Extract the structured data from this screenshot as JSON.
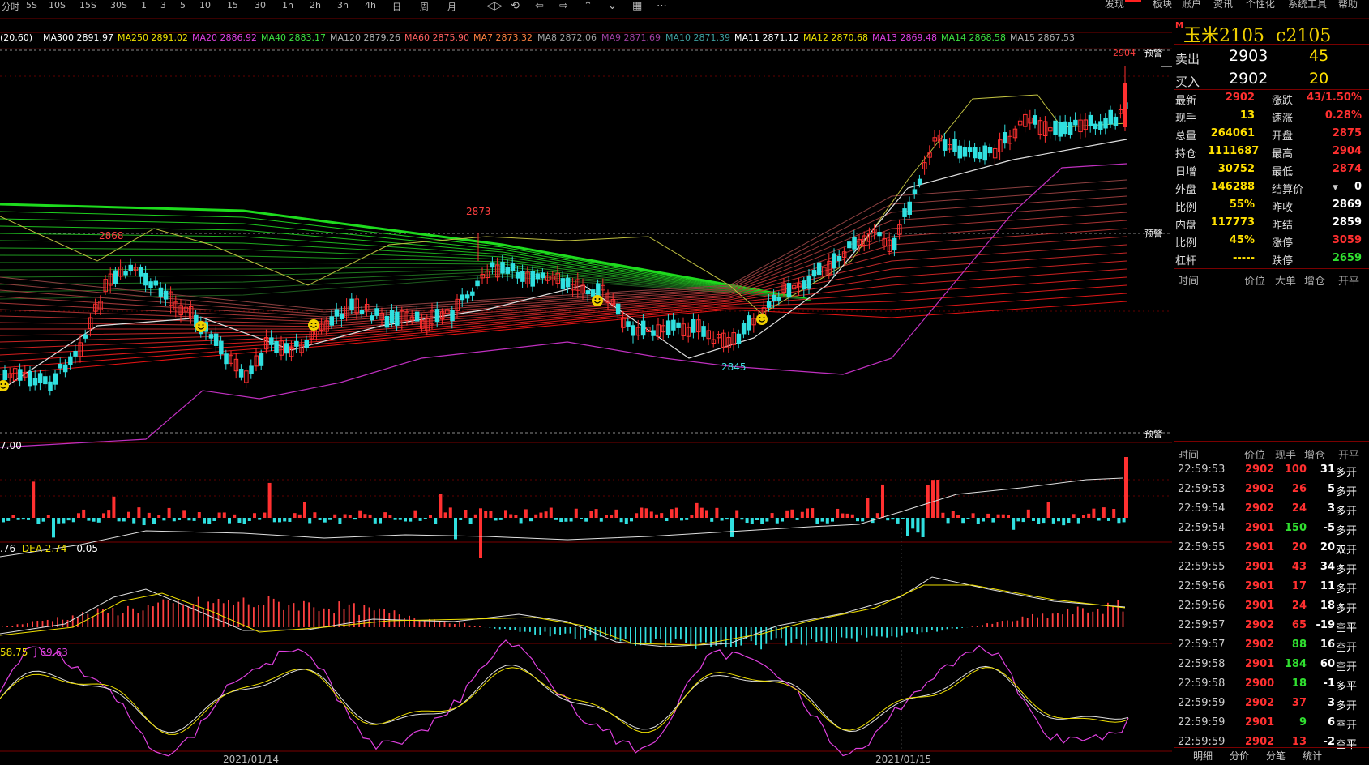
{
  "toolbar": {
    "periods": [
      "分时",
      "5S",
      "10S",
      "15S",
      "30S",
      "1",
      "3",
      "5",
      "10",
      "15",
      "30",
      "1h",
      "2h",
      "3h",
      "4h",
      "日",
      "周",
      "月"
    ],
    "menu": [
      "发现",
      "板块",
      "账户",
      "资讯",
      "个性化",
      "系统工具",
      "帮助"
    ]
  },
  "ma_line": [
    {
      "label": "(20,60)",
      "color": "#ffffff"
    },
    {
      "label": "MA300 2891.97",
      "color": "#ffffff"
    },
    {
      "label": "MA250 2891.02",
      "color": "#f0e000"
    },
    {
      "label": "MA20 2886.92",
      "color": "#e040e0"
    },
    {
      "label": "MA40 2883.17",
      "color": "#40e040"
    },
    {
      "label": "MA120 2879.26",
      "color": "#b0b0b0"
    },
    {
      "label": "MA60 2875.90",
      "color": "#ff6060"
    },
    {
      "label": "MA7 2873.32",
      "color": "#ff8040"
    },
    {
      "label": "MA8 2872.06",
      "color": "#a0a0a0"
    },
    {
      "label": "MA9 2871.69",
      "color": "#a040a0"
    },
    {
      "label": "MA10 2871.39",
      "color": "#40a0a0"
    },
    {
      "label": "MA11 2871.12",
      "color": "#ffffff"
    },
    {
      "label": "MA12 2870.68",
      "color": "#f0e000"
    },
    {
      "label": "MA13 2869.48",
      "color": "#e040e0"
    },
    {
      "label": "MA14 2868.58",
      "color": "#40e040"
    },
    {
      "label": "MA15 2867.53",
      "color": "#b0b0b0"
    }
  ],
  "price_labels": {
    "p2904": "2904",
    "p2873": "2873",
    "p2868": "2868",
    "p2845": "2845"
  },
  "warn": "预警",
  "vol_label": "7.00",
  "macd_label": {
    "a": ".76",
    "b": "DEA 2.74",
    "c": "0.05"
  },
  "kdj_label": {
    "a": "58.75",
    "b": "J 69.63"
  },
  "dates": [
    "2021/01/14",
    "2021/01/15"
  ],
  "instrument": {
    "name": "玉米2105",
    "code": "c2105",
    "marker": "M"
  },
  "sell": {
    "label": "卖出",
    "price": "2903",
    "vol": "45"
  },
  "buy": {
    "label": "买入",
    "price": "2902",
    "vol": "20"
  },
  "stats_left": [
    {
      "l": "最新",
      "v": "2902",
      "c": "#ff3030"
    },
    {
      "l": "现手",
      "v": "13",
      "c": "#ffe000"
    },
    {
      "l": "总量",
      "v": "264061",
      "c": "#ffe000"
    },
    {
      "l": "持仓",
      "v": "1111687",
      "c": "#ffe000"
    },
    {
      "l": "日增",
      "v": "30752",
      "c": "#ffe000"
    },
    {
      "l": "外盘",
      "v": "146288",
      "c": "#ffe000"
    },
    {
      "l": "比例",
      "v": "55%",
      "c": "#ffe000"
    },
    {
      "l": "内盘",
      "v": "117773",
      "c": "#ffe000"
    },
    {
      "l": "比例",
      "v": "45%",
      "c": "#ffe000"
    },
    {
      "l": "杠杆",
      "v": "-----",
      "c": "#ffe000"
    }
  ],
  "stats_right": [
    {
      "l": "涨跌",
      "v": "43/1.50%",
      "c": "#ff3030"
    },
    {
      "l": "速涨",
      "v": "0.28%",
      "c": "#ff3030"
    },
    {
      "l": "开盘",
      "v": "2875",
      "c": "#ff3030"
    },
    {
      "l": "最高",
      "v": "2904",
      "c": "#ff3030"
    },
    {
      "l": "最低",
      "v": "2874",
      "c": "#ff3030"
    },
    {
      "l": "结算价",
      "v": "0",
      "c": "#ffffff"
    },
    {
      "l": "昨收",
      "v": "2869",
      "c": "#ffffff"
    },
    {
      "l": "昨结",
      "v": "2859",
      "c": "#ffffff"
    },
    {
      "l": "涨停",
      "v": "3059",
      "c": "#ff3030"
    },
    {
      "l": "跌停",
      "v": "2659",
      "c": "#30e030"
    }
  ],
  "upper_header": [
    "时间",
    "价位",
    "大单",
    "增仓",
    "开平"
  ],
  "trade_header": [
    "时间",
    "价位",
    "现手",
    "增仓",
    "开平"
  ],
  "trades": [
    {
      "t": "22:59:53",
      "p": "2902",
      "v": "100",
      "d": "31",
      "k": "多开",
      "vc": "#ff3030"
    },
    {
      "t": "22:59:53",
      "p": "2902",
      "v": "26",
      "d": "5",
      "k": "多开",
      "vc": "#ff3030"
    },
    {
      "t": "22:59:54",
      "p": "2902",
      "v": "24",
      "d": "3",
      "k": "多开",
      "vc": "#ff3030"
    },
    {
      "t": "22:59:54",
      "p": "2901",
      "v": "150",
      "d": "-5",
      "k": "多开",
      "vc": "#30e030"
    },
    {
      "t": "22:59:55",
      "p": "2901",
      "v": "20",
      "d": "20",
      "k": "双开",
      "vc": "#ff3030"
    },
    {
      "t": "22:59:55",
      "p": "2901",
      "v": "43",
      "d": "34",
      "k": "多开",
      "vc": "#ff3030"
    },
    {
      "t": "22:59:56",
      "p": "2901",
      "v": "17",
      "d": "11",
      "k": "多开",
      "vc": "#ff3030"
    },
    {
      "t": "22:59:56",
      "p": "2901",
      "v": "24",
      "d": "18",
      "k": "多开",
      "vc": "#ff3030"
    },
    {
      "t": "22:59:57",
      "p": "2902",
      "v": "65",
      "d": "-19",
      "k": "空平",
      "vc": "#ff3030"
    },
    {
      "t": "22:59:57",
      "p": "2902",
      "v": "88",
      "d": "16",
      "k": "空开",
      "vc": "#30e030"
    },
    {
      "t": "22:59:58",
      "p": "2901",
      "v": "184",
      "d": "60",
      "k": "空开",
      "vc": "#30e030"
    },
    {
      "t": "22:59:58",
      "p": "2900",
      "v": "18",
      "d": "-1",
      "k": "多平",
      "vc": "#30e030"
    },
    {
      "t": "22:59:59",
      "p": "2902",
      "v": "37",
      "d": "3",
      "k": "多开",
      "vc": "#ff3030"
    },
    {
      "t": "22:59:59",
      "p": "2901",
      "v": "9",
      "d": "6",
      "k": "空开",
      "vc": "#30e030"
    },
    {
      "t": "22:59:59",
      "p": "2902",
      "v": "13",
      "d": "-2",
      "k": "空平",
      "vc": "#ff3030"
    }
  ],
  "bottom_tabs": [
    "明细",
    "分价",
    "分笔",
    "统计"
  ]
}
